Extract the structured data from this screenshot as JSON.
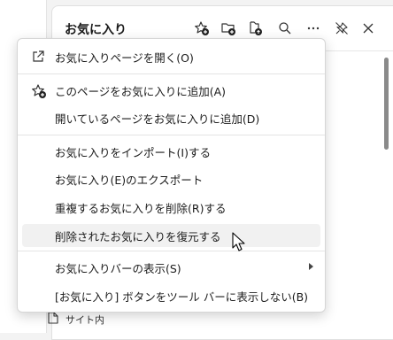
{
  "panel": {
    "title": "お気に入り",
    "header_icons": [
      "add-favorite-icon",
      "add-folder-icon",
      "collections-icon",
      "search-icon",
      "more-icon",
      "unpin-icon",
      "close-icon"
    ],
    "bottom_item": "サイト内"
  },
  "menu": {
    "items": [
      {
        "label": "お気に入りページを開く(O)",
        "icon": "open-external-icon"
      },
      {
        "label": "このページをお気に入りに追加(A)",
        "icon": "add-favorite-icon"
      },
      {
        "label": "開いているページをお気に入りに追加(D)"
      },
      {
        "label": "お気に入りをインポート(I)する"
      },
      {
        "label": "お気に入り(E)のエクスポート"
      },
      {
        "label": "重複するお気に入りを削除(R)する"
      },
      {
        "label": "削除されたお気に入りを復元する"
      },
      {
        "label": "お気に入りバーの表示(S)"
      },
      {
        "label": "[お気に入り] ボタンをツール バーに表示しない(B)"
      }
    ]
  }
}
